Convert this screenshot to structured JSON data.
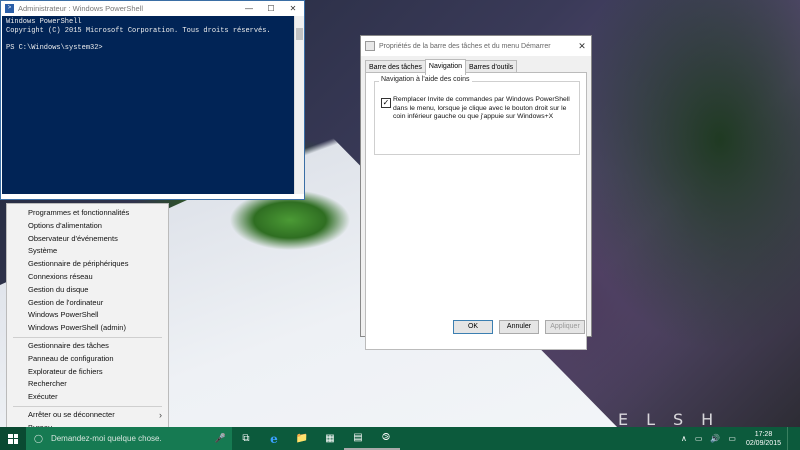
{
  "powershell": {
    "title": "Administrateur : Windows PowerShell",
    "lines": [
      "Windows PowerShell",
      "Copyright (C) 2015 Microsoft Corporation. Tous droits réservés.",
      "",
      "PS C:\\Windows\\system32>"
    ]
  },
  "winx_menu": {
    "group1": [
      "Programmes et fonctionnalités",
      "Options d'alimentation",
      "Observateur d'événements",
      "Système",
      "Gestionnaire de périphériques",
      "Connexions réseau",
      "Gestion du disque",
      "Gestion de l'ordinateur",
      "Windows PowerShell",
      "Windows PowerShell (admin)"
    ],
    "group2": [
      "Gestionnaire des tâches",
      "Panneau de configuration",
      "Explorateur de fichiers",
      "Rechercher",
      "Exécuter"
    ],
    "group3": [
      "Arrêter ou se déconnecter",
      "Bureau"
    ]
  },
  "dialog": {
    "title": "Propriétés de la barre des tâches et du menu Démarrer",
    "tabs": [
      "Barre des tâches",
      "Navigation",
      "Barres d'outils"
    ],
    "active_tab": "Navigation",
    "group_label": "Navigation à l'aide des coins",
    "checkbox_text": "Remplacer Invite de commandes par Windows PowerShell dans le menu, lorsque je clique avec le bouton droit sur le coin inférieur gauche ou que j'appuie sur Windows+X",
    "checkbox_checked": true,
    "buttons": {
      "ok": "OK",
      "cancel": "Annuler",
      "apply": "Appliquer"
    }
  },
  "taskbar": {
    "search_placeholder": "Demandez-moi quelque chose.",
    "time": "17:28",
    "date": "02/09/2015",
    "accent": "#0c5a3c"
  },
  "watermark": "ELSH"
}
